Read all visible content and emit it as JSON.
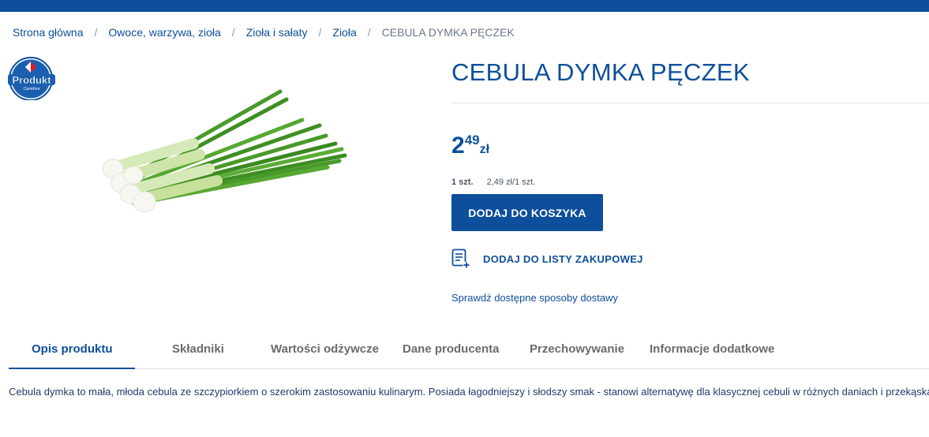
{
  "breadcrumb": {
    "items": [
      "Strona główna",
      "Owoce, warzywa, zioła",
      "Zioła i sałaty",
      "Zioła"
    ],
    "separator": "/",
    "current": "CEBULA DYMKA PĘCZEK"
  },
  "badge": {
    "text": "Produkt",
    "brand": "Carrefour"
  },
  "product": {
    "title": "CEBULA DYMKA PĘCZEK",
    "price_int": "2",
    "price_dec": "49",
    "currency": "zł",
    "unit_qty": "1 szt.",
    "unit_price": "2,49 zł/1 szt."
  },
  "actions": {
    "add_to_cart": "DODAJ DO KOSZYKA",
    "add_to_list": "DODAJ DO LISTY ZAKUPOWEJ",
    "delivery_link": "Sprawdź dostępne sposoby dostawy"
  },
  "tabs": [
    {
      "label": "Opis produktu",
      "active": true
    },
    {
      "label": "Składniki",
      "active": false
    },
    {
      "label": "Wartości odżywcze",
      "active": false
    },
    {
      "label": "Dane producenta",
      "active": false
    },
    {
      "label": "Przechowywanie",
      "active": false
    },
    {
      "label": "Informacje dodatkowe",
      "active": false
    }
  ],
  "description": "Cebula dymka to mała, młoda cebula ze szczypiorkiem o szerokim zastosowaniu kulinarym. Posiada łagodniejszy i słodszy smak - stanowi alternatywę dla klasycznej cebuli w różnych daniach i przekąska",
  "colors": {
    "brand_blue": "#0d4f9b",
    "tab_inactive": "#6b6b6b",
    "divider": "#dde3ea"
  },
  "icons": {
    "badge": "carrefour-produkt-badge",
    "list": "shopping-list-add-icon"
  }
}
